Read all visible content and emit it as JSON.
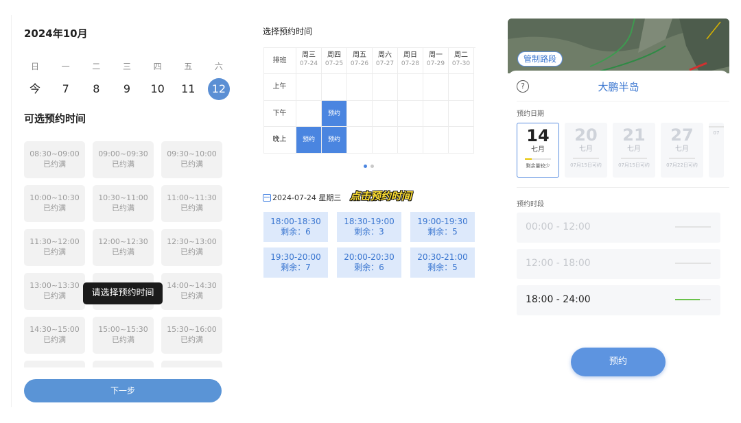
{
  "panel1": {
    "month_title": "2024年10月",
    "weekdays": [
      "日",
      "一",
      "二",
      "三",
      "四",
      "五",
      "六"
    ],
    "dates": [
      "今",
      "7",
      "8",
      "9",
      "10",
      "11",
      "12"
    ],
    "selected_date": "12",
    "section_title": "可选预约时间",
    "slots": [
      {
        "time": "08:30~09:00",
        "status": "已约满"
      },
      {
        "time": "09:00~09:30",
        "status": "已约满"
      },
      {
        "time": "09:30~10:00",
        "status": "已约满"
      },
      {
        "time": "10:00~10:30",
        "status": "已约满"
      },
      {
        "time": "10:30~11:00",
        "status": "已约满"
      },
      {
        "time": "11:00~11:30",
        "status": "已约满"
      },
      {
        "time": "11:30~12:00",
        "status": "已约满"
      },
      {
        "time": "12:00~12:30",
        "status": "已约满"
      },
      {
        "time": "12:30~13:00",
        "status": "已约满"
      },
      {
        "time": "13:00~13:30",
        "status": "已约满"
      },
      {
        "time": "",
        "status": ""
      },
      {
        "time": "14:00~14:30",
        "status": "已约满"
      },
      {
        "time": "14:30~15:00",
        "status": "已约满"
      },
      {
        "time": "15:00~15:30",
        "status": "已约满"
      },
      {
        "time": "15:30~16:00",
        "status": "已约满"
      },
      {
        "time": "",
        "status": ""
      },
      {
        "time": "",
        "status": ""
      },
      {
        "time": "",
        "status": ""
      }
    ],
    "toast": "请选择预约时间",
    "next_button": "下一步"
  },
  "panel2": {
    "title": "选择预约时间",
    "corner_label": "排班",
    "columns": [
      {
        "day": "周三",
        "date": "07-24"
      },
      {
        "day": "周四",
        "date": "07-25"
      },
      {
        "day": "周五",
        "date": "07-26"
      },
      {
        "day": "周六",
        "date": "07-27"
      },
      {
        "day": "周日",
        "date": "07-28"
      },
      {
        "day": "周一",
        "date": "07-29"
      },
      {
        "day": "周二",
        "date": "07-30"
      }
    ],
    "rows": [
      "上午",
      "下午",
      "晚上"
    ],
    "booked_label": "预约",
    "date_line": "2024-07-24 星期三",
    "hint": "点击预约时间",
    "time_slots": [
      {
        "time": "18:00-18:30",
        "remain": "剩余：6"
      },
      {
        "time": "18:30-19:00",
        "remain": "剩余：3"
      },
      {
        "time": "19:00-19:30",
        "remain": "剩余：5"
      },
      {
        "time": "19:30-20:00",
        "remain": "剩余：7"
      },
      {
        "time": "20:00-20:30",
        "remain": "剩余：6"
      },
      {
        "time": "20:30-21:00",
        "remain": "剩余：5"
      }
    ]
  },
  "panel3": {
    "map_badge": "管制路段",
    "place": "大鹏半岛",
    "date_label": "预约日期",
    "date_cards": [
      {
        "day": "14",
        "month": "七月",
        "note": "剩余量较少",
        "level": 0.25
      },
      {
        "day": "20",
        "month": "七月",
        "note": "07月15日可约",
        "level": 0
      },
      {
        "day": "21",
        "month": "七月",
        "note": "07月15日可约",
        "level": 0
      },
      {
        "day": "27",
        "month": "七月",
        "note": "07月22日可约",
        "level": 0
      },
      {
        "day": "",
        "month": "",
        "note": "07",
        "level": 0
      }
    ],
    "period_label": "预约时段",
    "periods": [
      {
        "label": "00:00 - 12:00",
        "level": 0
      },
      {
        "label": "12:00 - 18:00",
        "level": 0
      },
      {
        "label": "18:00 - 24:00",
        "level": 0.7
      }
    ],
    "book_button": "预约"
  }
}
